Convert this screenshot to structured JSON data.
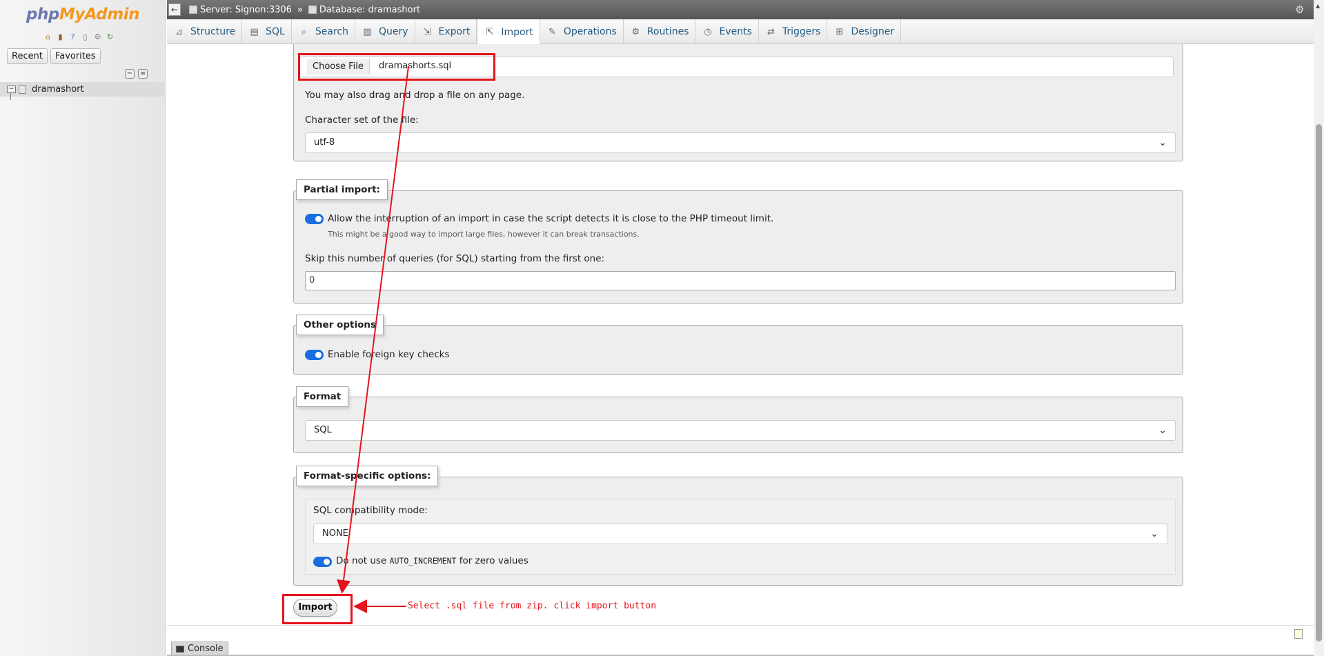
{
  "nav": {
    "logo_php": "php",
    "logo_myadmin": "MyAdmin",
    "icons": [
      "home-icon",
      "logout-icon",
      "help-icon",
      "docs-icon",
      "settings-icon",
      "reload-icon"
    ],
    "recent_label": "Recent",
    "favorites_label": "Favorites",
    "database": "dramashort"
  },
  "breadcrumb": {
    "server": "Server: Signon:3306",
    "separator": "»",
    "database": "Database: dramashort"
  },
  "tabs": [
    {
      "label": "Structure",
      "icon": "structure-icon"
    },
    {
      "label": "SQL",
      "icon": "sql-icon"
    },
    {
      "label": "Search",
      "icon": "search-icon"
    },
    {
      "label": "Query",
      "icon": "query-icon"
    },
    {
      "label": "Export",
      "icon": "export-icon"
    },
    {
      "label": "Import",
      "icon": "import-icon",
      "active": true
    },
    {
      "label": "Operations",
      "icon": "operations-icon"
    },
    {
      "label": "Routines",
      "icon": "routines-icon"
    },
    {
      "label": "Events",
      "icon": "events-icon"
    },
    {
      "label": "Triggers",
      "icon": "triggers-icon"
    },
    {
      "label": "Designer",
      "icon": "designer-icon"
    }
  ],
  "file_section": {
    "choose_file": "Choose File",
    "filename": "dramashorts.sql",
    "drag_drop_hint": "You may also drag and drop a file on any page.",
    "charset_label": "Character set of the file:",
    "charset_value": "utf-8"
  },
  "partial_import": {
    "legend": "Partial import:",
    "allow_interrupt": "Allow the interruption of an import in case the script detects it is close to the PHP timeout limit.",
    "allow_interrupt_hint": "This might be a good way to import large files, however it can break transactions.",
    "skip_label": "Skip this number of queries (for SQL) starting from the first one:",
    "skip_value": "0"
  },
  "other_options": {
    "legend": "Other options",
    "foreign_key_checks": "Enable foreign key checks"
  },
  "format": {
    "legend": "Format",
    "value": "SQL"
  },
  "format_specific": {
    "legend": "Format-specific options:",
    "compat_label": "SQL compatibility mode:",
    "compat_value": "NONE",
    "auto_inc_pre": "Do not use",
    "auto_inc_code": "AUTO_INCREMENT",
    "auto_inc_post": "for zero values"
  },
  "import_button": "Import",
  "annotation": "Select .sql file from zip. click import button",
  "console_label": "Console",
  "colors": {
    "accent_red": "#e5131b",
    "toggle_blue": "#1a6de0",
    "link_blue": "#235a81"
  }
}
